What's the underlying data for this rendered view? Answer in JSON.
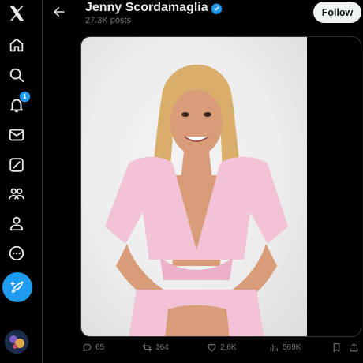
{
  "sidebar": {
    "items": [
      {
        "name": "x-logo-icon"
      },
      {
        "name": "home-icon"
      },
      {
        "name": "explore-icon"
      },
      {
        "name": "notifications-icon",
        "badge": "1"
      },
      {
        "name": "messages-icon"
      },
      {
        "name": "grok-icon"
      },
      {
        "name": "communities-icon"
      },
      {
        "name": "profile-icon"
      },
      {
        "name": "more-icon"
      }
    ],
    "post_button": "compose-post-icon"
  },
  "header": {
    "name": "Jenny Scordamaglia",
    "posts": "27.3K posts",
    "follow_label": "Follow",
    "verified": true
  },
  "post": {
    "replies": "65",
    "reposts": "164",
    "likes": "2.6K",
    "views": "569K"
  },
  "colors": {
    "accent": "#1d9bf0",
    "background": "#000000",
    "muted": "#71767b",
    "follow_bg": "#eff3f4"
  }
}
